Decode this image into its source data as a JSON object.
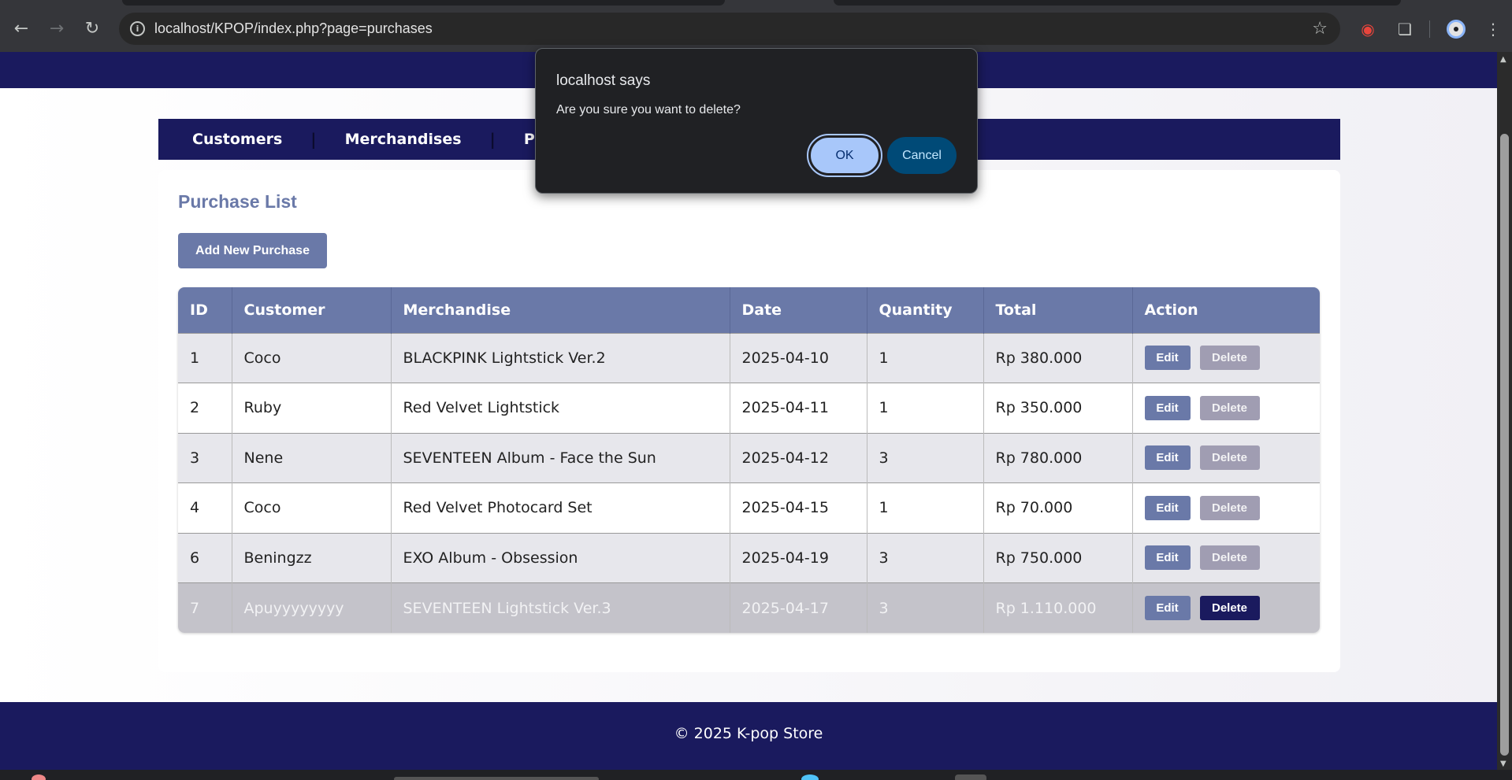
{
  "browser": {
    "url": "localhost/KPOP/index.php?page=purchases",
    "back_icon": "arrow-left-icon",
    "forward_icon": "arrow-right-icon",
    "reload_icon": "reload-icon",
    "info_icon": "info-icon",
    "star_icon": "star-icon"
  },
  "nav": {
    "items": [
      "Customers",
      "Merchandises",
      "Purch"
    ]
  },
  "main": {
    "title": "Purchase List",
    "add_button": "Add New Purchase"
  },
  "table": {
    "headers": [
      "ID",
      "Customer",
      "Merchandise",
      "Date",
      "Quantity",
      "Total",
      "Action"
    ],
    "rows": [
      {
        "id": "1",
        "customer": "Coco",
        "merchandise": "BLACKPINK Lightstick Ver.2",
        "date": "2025-04-10",
        "quantity": "1",
        "total": "Rp 380.000"
      },
      {
        "id": "2",
        "customer": "Ruby",
        "merchandise": "Red Velvet Lightstick",
        "date": "2025-04-11",
        "quantity": "1",
        "total": "Rp 350.000"
      },
      {
        "id": "3",
        "customer": "Nene",
        "merchandise": "SEVENTEEN Album - Face the Sun",
        "date": "2025-04-12",
        "quantity": "3",
        "total": "Rp 780.000"
      },
      {
        "id": "4",
        "customer": "Coco",
        "merchandise": "Red Velvet Photocard Set",
        "date": "2025-04-15",
        "quantity": "1",
        "total": "Rp 70.000"
      },
      {
        "id": "6",
        "customer": "Beningzz",
        "merchandise": "EXO Album - Obsession",
        "date": "2025-04-19",
        "quantity": "3",
        "total": "Rp 750.000"
      },
      {
        "id": "7",
        "customer": "Apuyyyyyyyy",
        "merchandise": "SEVENTEEN Lightstick Ver.3",
        "date": "2025-04-17",
        "quantity": "3",
        "total": "Rp 1.110.000"
      }
    ],
    "edit_label": "Edit",
    "delete_label": "Delete"
  },
  "footer": {
    "text": "© 2025 K-pop Store"
  },
  "dialog": {
    "title": "localhost says",
    "message": "Are you sure you want to delete?",
    "ok_label": "OK",
    "cancel_label": "Cancel"
  },
  "colors": {
    "navy": "#1a1a5e",
    "accent": "#6a79a8",
    "delete_muted": "#a09db2",
    "ok_button": "#a8c7fa"
  }
}
